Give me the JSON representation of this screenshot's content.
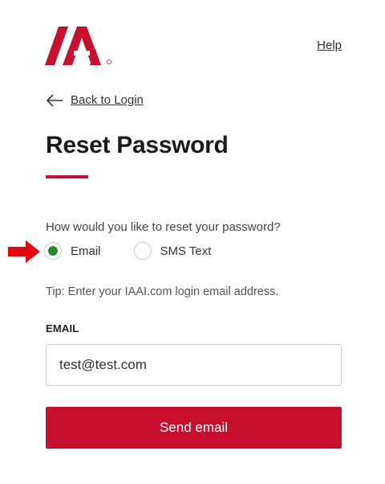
{
  "header": {
    "logo_text": "IAA",
    "help_label": "Help"
  },
  "nav": {
    "back_label": "Back to Login"
  },
  "main": {
    "title": "Reset Password",
    "question": "How would you like to reset your password?",
    "options": [
      {
        "label": "Email",
        "selected": true
      },
      {
        "label": "SMS Text",
        "selected": false
      }
    ],
    "tip": "Tip: Enter your IAAI.com login email address.",
    "email_label": "EMAIL",
    "email_value": "test@test.com",
    "submit_label": "Send email"
  },
  "colors": {
    "brand": "#c8102e",
    "radio_selected": "#2b8a2b"
  },
  "icons": {
    "back": "arrow-left-icon",
    "annotation": "red-pointer-arrow-icon"
  }
}
